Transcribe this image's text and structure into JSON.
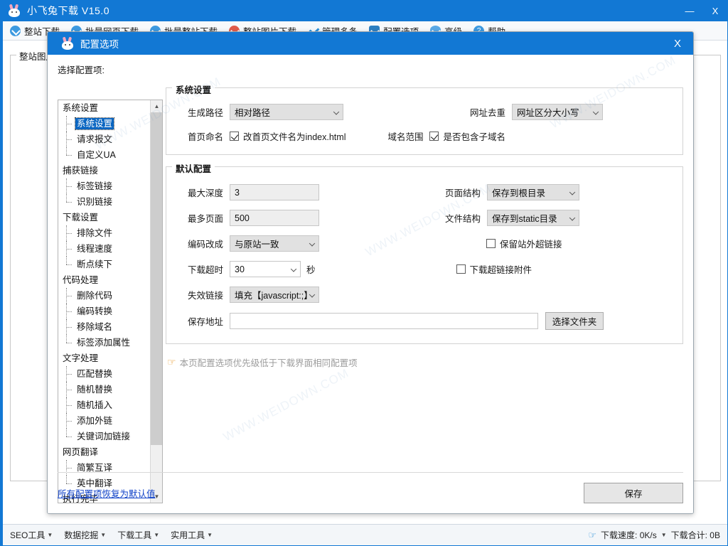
{
  "window": {
    "title": "小飞兔下载 V15.0",
    "logo_icon": "rabbit-icon",
    "minimize_label": "—",
    "close_label": "X"
  },
  "toolbar": {
    "items": [
      {
        "label": "整站下载",
        "icon": "cloud-download-icon"
      },
      {
        "label": "批量网页下载",
        "icon": "cloud-download-icon"
      },
      {
        "label": "批量整站下载",
        "icon": "cloud-download-icon"
      },
      {
        "label": "整站图片下载",
        "icon": "image-download-icon"
      },
      {
        "label": "管理多条",
        "icon": "check-icon"
      },
      {
        "label": "配置选项",
        "icon": "gear-icon"
      },
      {
        "label": "高级",
        "icon": "shield-icon"
      },
      {
        "label": "帮助",
        "icon": "help-icon"
      }
    ]
  },
  "background": {
    "groupbox_legend": "整站图片下载"
  },
  "dialog": {
    "title": "配置选项",
    "logo_icon": "rabbit-icon",
    "close_label": "X",
    "tree_label": "选择配置项:",
    "tree": [
      {
        "label": "系统设置",
        "type": "group"
      },
      {
        "label": "系统设置",
        "type": "child",
        "selected": true
      },
      {
        "label": "请求报文",
        "type": "child"
      },
      {
        "label": "自定义UA",
        "type": "child",
        "last": true
      },
      {
        "label": "捕获链接",
        "type": "group"
      },
      {
        "label": "标签链接",
        "type": "child"
      },
      {
        "label": "识别链接",
        "type": "child",
        "last": true
      },
      {
        "label": "下载设置",
        "type": "group"
      },
      {
        "label": "排除文件",
        "type": "child"
      },
      {
        "label": "线程速度",
        "type": "child"
      },
      {
        "label": "断点续下",
        "type": "child",
        "last": true
      },
      {
        "label": "代码处理",
        "type": "group"
      },
      {
        "label": "删除代码",
        "type": "child"
      },
      {
        "label": "编码转换",
        "type": "child"
      },
      {
        "label": "移除域名",
        "type": "child"
      },
      {
        "label": "标签添加属性",
        "type": "child",
        "last": true
      },
      {
        "label": "文字处理",
        "type": "group"
      },
      {
        "label": "匹配替换",
        "type": "child"
      },
      {
        "label": "随机替换",
        "type": "child"
      },
      {
        "label": "随机插入",
        "type": "child"
      },
      {
        "label": "添加外链",
        "type": "child"
      },
      {
        "label": "关键词加链接",
        "type": "child",
        "last": true
      },
      {
        "label": "网页翻译",
        "type": "group"
      },
      {
        "label": "简繁互译",
        "type": "child"
      },
      {
        "label": "英中翻译",
        "type": "child",
        "last": true
      },
      {
        "label": "执行完毕",
        "type": "group"
      }
    ],
    "system_settings": {
      "title": "系统设置",
      "gen_path_label": "生成路径",
      "gen_path_value": "相对路径",
      "url_dedup_label": "网址去重",
      "url_dedup_value": "网址区分大小写",
      "home_name_label": "首页命名",
      "home_name_checkbox": "改首页文件名为index.html",
      "home_name_checked": true,
      "domain_scope_label": "域名范围",
      "domain_scope_checkbox": "是否包含子域名",
      "domain_scope_checked": true
    },
    "default_config": {
      "title": "默认配置",
      "max_depth_label": "最大深度",
      "max_depth_value": "3",
      "max_pages_label": "最多页面",
      "max_pages_value": "500",
      "encoding_label": "编码改成",
      "encoding_value": "与原站一致",
      "timeout_label": "下载超时",
      "timeout_value": "30",
      "timeout_unit": "秒",
      "deadlink_label": "失效链接",
      "deadlink_value": "填充【javascript:;】",
      "savepath_label": "保存地址",
      "savepath_value": "",
      "choose_folder_button": "选择文件夹",
      "page_struct_label": "页面结构",
      "page_struct_value": "保存到根目录",
      "file_struct_label": "文件结构",
      "file_struct_value": "保存到static目录",
      "keep_external_checkbox": "保留站外超链接",
      "keep_external_checked": false,
      "download_attach_checkbox": "下载超链接附件",
      "download_attach_checked": false
    },
    "note": "本页配置选项优先级低于下载界面相同配置项",
    "note_icon": "pointing-hand-icon",
    "reset_link": "所有配置项恢复为默认值",
    "save_button": "保存"
  },
  "status_bar": {
    "left_items": [
      {
        "label": "SEO工具"
      },
      {
        "label": "数据挖掘"
      },
      {
        "label": "下载工具"
      },
      {
        "label": "实用工具"
      }
    ],
    "download_speed": "下载速度: 0K/s",
    "download_total": "下载合计: 0B"
  },
  "colors": {
    "accent": "#1278d4",
    "selection": "#0a66c2",
    "link": "#1042c8",
    "note": "#9c9c9c",
    "note_icon": "#e8a33d"
  },
  "watermarks": [
    "WWW.WEIDOWN.COM",
    "WWW.WEIDOWN.COM",
    "WWW.WEIDOWN.COM",
    "WWW.WEIDOWN.COM"
  ]
}
